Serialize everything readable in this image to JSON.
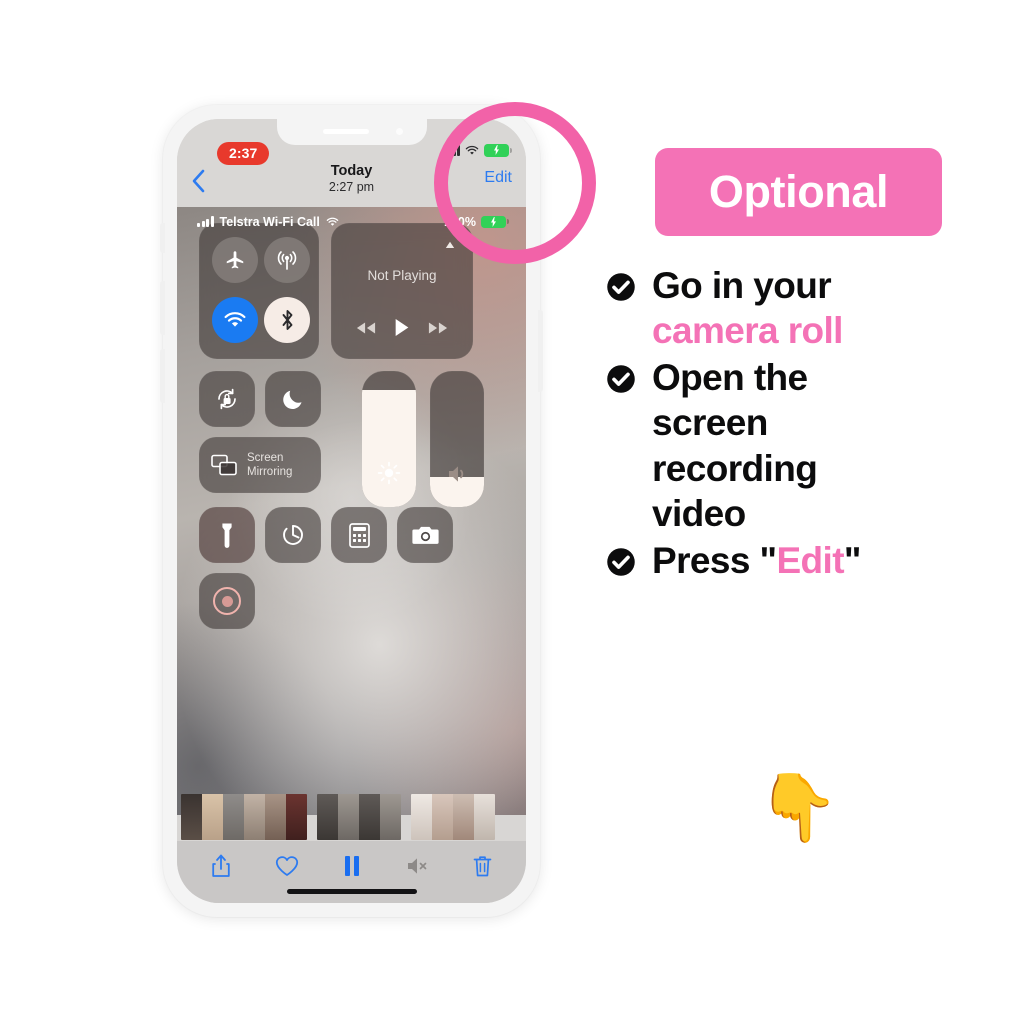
{
  "phone": {
    "status_bar": {
      "recording_time": "2:37",
      "signal_icon": "cellular-bars-icon",
      "wifi_icon": "wifi-icon",
      "battery_icon": "battery-charging-icon"
    },
    "nav_bar": {
      "back_icon": "chevron-left-icon",
      "title": "Today",
      "subtitle": "2:27 pm",
      "edit_label": "Edit"
    },
    "control_center": {
      "cc_status": {
        "carrier": "Telstra Wi-Fi Call",
        "signal_icon": "cellular-bars-icon",
        "wifi_icon": "wifi-icon",
        "battery_percent": "100%",
        "battery_icon": "battery-charging-icon"
      },
      "connectivity": {
        "airplane_mode": {
          "name": "airplane-icon",
          "state": "off"
        },
        "cellular_data": {
          "name": "cellular-antenna-icon",
          "state": "off"
        },
        "wifi": {
          "name": "wifi-icon",
          "state": "on"
        },
        "bluetooth": {
          "name": "bluetooth-icon",
          "state": "on"
        }
      },
      "media": {
        "now_playing": "Not Playing",
        "airplay_icon": "airplay-icon",
        "rewind_icon": "rewind-icon",
        "play_icon": "play-icon",
        "forward_icon": "fast-forward-icon"
      },
      "rotation_lock": {
        "label": "rotation-lock-icon",
        "state": "off"
      },
      "do_not_disturb": {
        "label": "moon-icon",
        "state": "off"
      },
      "screen_mirroring": {
        "label_line1": "Screen",
        "label_line2": "Mirroring",
        "icon": "screen-mirroring-icon"
      },
      "brightness": {
        "icon": "brightness-icon",
        "value": 86
      },
      "volume": {
        "icon": "speaker-icon",
        "value": 22
      },
      "utilities": [
        {
          "name": "flashlight-icon",
          "active": true
        },
        {
          "name": "timer-icon",
          "active": false
        },
        {
          "name": "calculator-icon",
          "active": false
        },
        {
          "name": "camera-icon",
          "active": false
        },
        {
          "name": "screen-recording-icon",
          "active": true
        }
      ]
    },
    "player_toolbar": {
      "share_icon": "share-icon",
      "favorite_icon": "heart-icon",
      "pause_icon": "pause-icon",
      "mute_icon": "speaker-muted-icon",
      "delete_icon": "trash-icon"
    }
  },
  "annotation": {
    "highlight_shape": "circle",
    "highlight_color": "#f262a8",
    "badge_label": "Optional",
    "badge_color": "#f472b6",
    "pointer_emoji": "👇",
    "steps": [
      {
        "prefix": "Go in your",
        "accent": "camera roll",
        "suffix": ""
      },
      {
        "prefix": "Open the",
        "accent": "",
        "suffix": "",
        "lines": [
          "Open the",
          "screen",
          "recording",
          "video"
        ]
      },
      {
        "prefix": "Press \"",
        "accent": "Edit",
        "suffix": "\""
      }
    ],
    "check_icon": "check-circle-icon"
  }
}
